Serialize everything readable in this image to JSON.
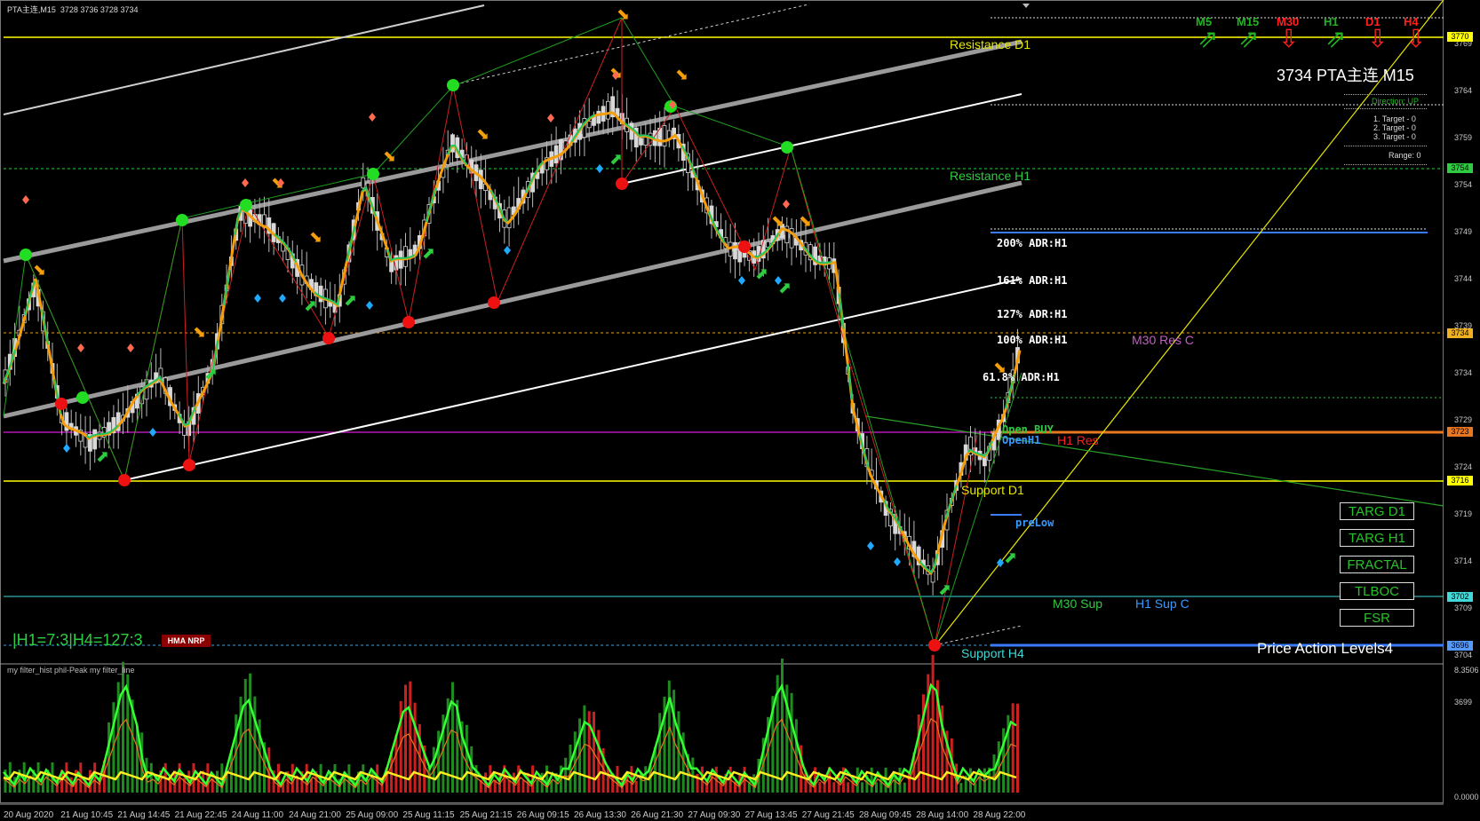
{
  "window": {
    "title": "PTA主连,M15",
    "ohlc": "3728 3736 3728 3734"
  },
  "info": {
    "header": "3734 PTA主连 M15",
    "direction": "Direction: UP",
    "target1": "1. Target - 0",
    "target2": "2. Target - 0",
    "target3": "3. Target - 0",
    "range": "Range: 0"
  },
  "timeframes": [
    {
      "label": "M5",
      "color": "#1fb61f",
      "dir": "up"
    },
    {
      "label": "M15",
      "color": "#1fb61f",
      "dir": "up"
    },
    {
      "label": "M30",
      "color": "#ff2020",
      "dir": "down"
    },
    {
      "label": "H1",
      "color": "#1fb61f",
      "dir": "up"
    },
    {
      "label": "D1",
      "color": "#ff2020",
      "dir": "down"
    },
    {
      "label": "H4",
      "color": "#ff2020",
      "dir": "down"
    }
  ],
  "levels": {
    "resistance_d1": "Resistance D1",
    "resistance_h1": "Resistance H1",
    "support_d1": "Support D1",
    "support_h4": "Support H4",
    "m30_res_c": "M30 Res C",
    "h1_res": "H1 Res",
    "m30_sup": "M30 Sup",
    "h1_sup_c": "H1 Sup C",
    "open_buy": "Open BUY",
    "open_h1": "OpenH1",
    "prelow": "preLow",
    "pal4": "Price Action Levels4"
  },
  "adr": [
    "200% ADR:H1",
    "161% ADR:H1",
    "127% ADR:H1",
    "100% ADR:H1",
    "61.8% ADR:H1"
  ],
  "buttons": [
    "TARG D1",
    "TARG H1",
    "FRACTAL",
    "TLBOC",
    "FSR"
  ],
  "ratio_text": "|H1=7:3|H4=127:3",
  "hma_badge": "HMA NRP",
  "price_tags": [
    {
      "text": "3770",
      "color": "#ffff00"
    },
    {
      "text": "3754",
      "color": "#2ecc40"
    },
    {
      "text": "3734",
      "color": "#f0b020"
    },
    {
      "text": "3723",
      "color": "#e87722"
    },
    {
      "text": "3716",
      "color": "#ffff00"
    },
    {
      "text": "3702",
      "color": "#40d8d8"
    },
    {
      "text": "3696",
      "color": "#5599ff"
    }
  ],
  "price_axis": [
    "3769",
    "3764",
    "3759",
    "3754",
    "3749",
    "3744",
    "3739",
    "3734",
    "3729",
    "3724",
    "3719",
    "3714",
    "3709",
    "3704",
    "3699"
  ],
  "date_axis": [
    "20 Aug 2020",
    "21 Aug 10:45",
    "21 Aug 14:45",
    "21 Aug 22:45",
    "24 Aug 11:00",
    "24 Aug 21:00",
    "25 Aug 09:00",
    "25 Aug 11:15",
    "25 Aug 21:15",
    "26 Aug 09:15",
    "26 Aug 13:30",
    "26 Aug 21:30",
    "27 Aug 09:30",
    "27 Aug 13:45",
    "27 Aug 21:45",
    "28 Aug 09:45",
    "28 Aug 14:00",
    "28 Aug 22:00"
  ],
  "subwindow": {
    "label": "my filter_hist  phil-Peak  my filter_line",
    "scale_top": "8.3506",
    "scale_bottom": "0.0000"
  },
  "colors": {
    "bg": "#000000",
    "up_ma": "#22c55e",
    "down_ma": "#f59e0b",
    "channel": "#9a9a9a"
  }
}
